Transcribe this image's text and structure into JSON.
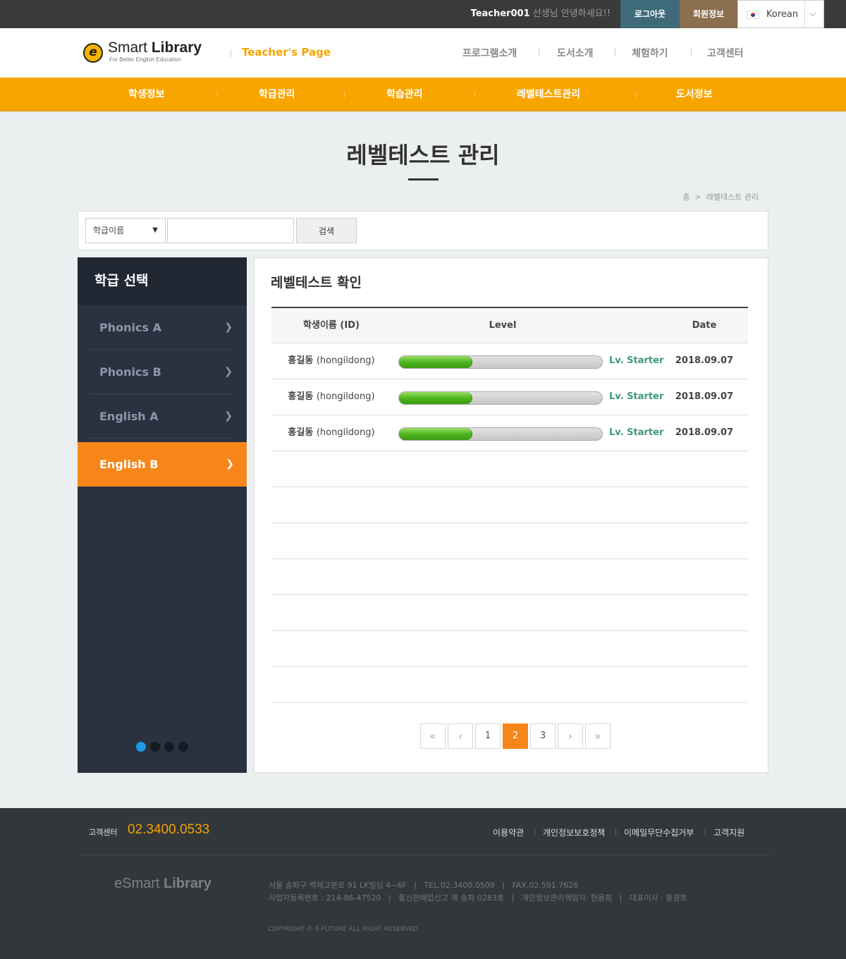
{
  "topbar": {
    "user_id": "Teacher001",
    "greeting": "선생님 안녕하세요!!",
    "logout": "로그아웃",
    "member_info": "회원정보",
    "language": "Korean"
  },
  "header": {
    "logo_mark": "e",
    "logo_name_regular": "Smart",
    "logo_name_bold": "Library",
    "logo_tagline": "For Better English Education",
    "teacher_page": "Teacher's Page",
    "nav": [
      "프로그램소개",
      "도서소개",
      "체험하기",
      "고객센터"
    ]
  },
  "gnb": [
    "학생정보",
    "학급관리",
    "학습관리",
    "레벨테스트관리",
    "도서정보"
  ],
  "page": {
    "title": "레벨테스트 관리",
    "breadcrumb_home": "홈",
    "breadcrumb_sep": ">",
    "breadcrumb_current": "레벨테스트 관리"
  },
  "search": {
    "select_value": "학급이름",
    "input_value": "",
    "button": "검색"
  },
  "sidebar": {
    "heading": "학급 선택",
    "items": [
      {
        "label": "Phonics A",
        "active": false
      },
      {
        "label": "Phonics B",
        "active": false
      },
      {
        "label": "English A",
        "active": false
      },
      {
        "label": "English B",
        "active": true
      }
    ],
    "carousel_dots": 4,
    "carousel_active": 1
  },
  "panel": {
    "title": "레벨테스트 확인",
    "columns": [
      "학생이름 (ID)",
      "Level",
      "Date"
    ],
    "rows": [
      {
        "name": "홍길동",
        "id": "(hongildong)",
        "progress": 0.36,
        "level": "Lv. Starter",
        "date": "2018.09.07"
      },
      {
        "name": "홍길동",
        "id": "(hongildong)",
        "progress": 0.36,
        "level": "Lv. Starter",
        "date": "2018.09.07"
      },
      {
        "name": "홍길동",
        "id": "(hongildong)",
        "progress": 0.36,
        "level": "Lv. Starter",
        "date": "2018.09.07"
      }
    ],
    "empty_rows": 7
  },
  "pagination": {
    "first": "«",
    "prev": "‹",
    "pages": [
      "1",
      "2",
      "3"
    ],
    "current": "2",
    "next": "›",
    "last": "»"
  },
  "footer": {
    "cs_label": "고객센터",
    "cs_number": "02.3400.0533",
    "links": [
      "이용약관",
      "개인정보보호정책",
      "이메일무단수집거부",
      "고객지원"
    ],
    "logo_regular": "eSmart",
    "logo_bold": "Library",
    "address_line1": "서울 송파구 백제고분로 91 LK빌딩 4~6F   |   TEL.02.3400.0509   |   FAX.02.591.7626",
    "address_line2": "사업자등록번호 : 214-86-47520   |   통신판매업신고 제 송파 0283호   |   개인정보관리책임자: 현용희   |   대표이사 : 황경호",
    "copyright": "COPYRIGHT © E-FUTURE ALL RIGHT RESERVED."
  },
  "colors": {
    "accent_orange": "#f8a500",
    "active_orange": "#f7861a",
    "sidebar_bg": "#2a3140",
    "logout_bg": "#3e6a7a",
    "member_bg": "#8b6e4e",
    "level_text": "#3c9a74",
    "progress_green": "#4fb51e",
    "dot_active": "#1d9be4"
  }
}
